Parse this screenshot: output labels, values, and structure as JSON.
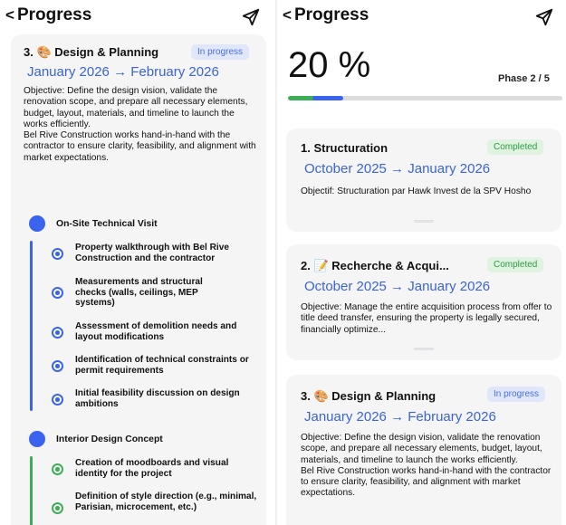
{
  "colors": {
    "accent": "#3a64d8",
    "in_progress_bg": "#e0e7fb",
    "completed_bg": "#dff3e0",
    "completed_text": "#2e9b44",
    "timeline_blue": "#3a64f0",
    "timeline_green": "#3cae55"
  },
  "left": {
    "title": "Progress",
    "card": {
      "title": "3. 🎨 Design & Planning",
      "status": "In progress",
      "dates": "January 2026 → February 2026",
      "objective": "Objective: Define the design vision, validate the renovation scope, and prepare all necessary elements, budget, layout, materials, and timeline to launch the works efficiently.\nBel Rive Construction works hand-in-hand with the contractor to ensure clarity, feasibility, and alignment with market expectations."
    },
    "milestones": [
      {
        "title": "On-Site Technical Visit",
        "color": "blue",
        "steps": [
          "Property walkthrough with Bel Rive Construction and the contractor",
          "Measurements and structural checks (walls, ceilings, MEP systems)",
          "Assessment of demolition needs and layout modifications",
          "Identification of technical constraints or permit requirements",
          "Initial feasibility discussion on design ambitions"
        ]
      },
      {
        "title": "Interior Design Concept",
        "color": "green",
        "steps": [
          "Creation of moodboards and visual identity for the project",
          "Definition of style direction (e.g., minimal, Parisian, microcement, etc.)"
        ]
      }
    ]
  },
  "right": {
    "title": "Progress",
    "percent": "20 %",
    "progress_fraction": 0.2,
    "phase": "Phase 2 / 5",
    "cards": [
      {
        "title": "1. Structuration",
        "status": "Completed",
        "dates": "October 2025 → January 2026",
        "objective": "Objectif: Structuration par Hawk Invest de la SPV Hosho"
      },
      {
        "title": "2. 📝 Recherche & Acqui...",
        "status": "Completed",
        "dates": "October 2025 → January 2026",
        "objective": "Objective: Manage the entire acquisition process from offer to title deed transfer, ensuring the property is legally secured, financially optimize..."
      },
      {
        "title": "3. 🎨 Design & Planning",
        "status": "In progress",
        "dates": "January 2026 → February 2026",
        "objective": "Objective: Define the design vision, validate the renovation scope, and prepare all necessary elements, budget, layout, materials, and timeline to launch the works efficiently.\nBel Rive Construction works hand-in-hand with the contractor to ensure clarity, feasibility, and alignment with market expectations."
      }
    ]
  }
}
